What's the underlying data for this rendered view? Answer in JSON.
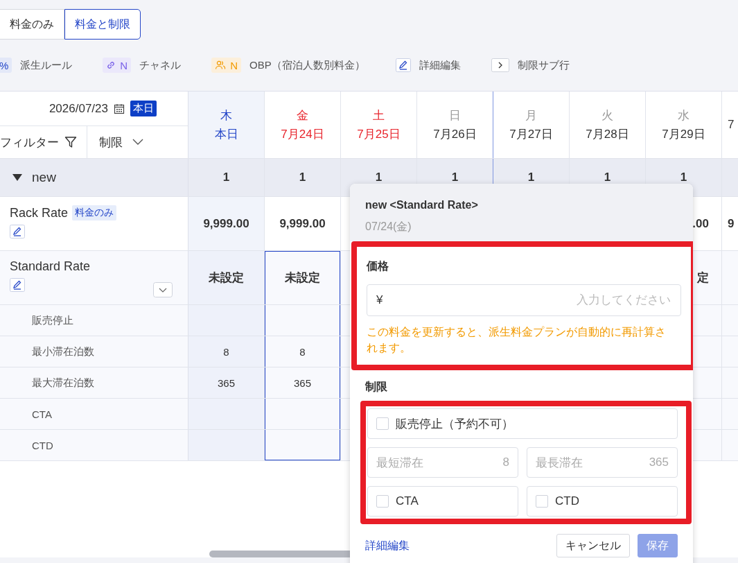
{
  "tabs": [
    {
      "label": "料金のみ",
      "selected": false
    },
    {
      "label": "料金と制限",
      "selected": true
    }
  ],
  "legend": [
    {
      "kind": "percent",
      "badge": "%",
      "label": "派生ルール"
    },
    {
      "kind": "link",
      "badge": "N",
      "label": "チャネル"
    },
    {
      "kind": "people",
      "badge": "N",
      "label": "OBP（宿泊人数別料金）"
    },
    {
      "kind": "edit",
      "label": "詳細編集"
    },
    {
      "kind": "chevron",
      "label": "制限サブ行"
    }
  ],
  "table": {
    "date_picker": {
      "date": "2026/07/23",
      "today_button": "本日"
    },
    "filter": {
      "label": "フィルター"
    },
    "view_select": {
      "value": "制限"
    },
    "columns": [
      {
        "weekday": "木",
        "date": "本日",
        "kind": "today",
        "selected": false
      },
      {
        "weekday": "金",
        "date": "7月24日",
        "kind": "holiday",
        "selected": true
      },
      {
        "weekday": "土",
        "date": "7月25日",
        "kind": "holiday",
        "selected": false
      },
      {
        "weekday": "日",
        "date": "7月26日",
        "kind": "plain",
        "selected": false
      },
      {
        "weekday": "月",
        "date": "7月27日",
        "kind": "plain",
        "selected": false,
        "week_start": true
      },
      {
        "weekday": "火",
        "date": "7月28日",
        "kind": "plain",
        "selected": false
      },
      {
        "weekday": "水",
        "date": "7月29日",
        "kind": "plain",
        "selected": false
      },
      {
        "date": "7",
        "kind": "edge",
        "selected": false
      }
    ],
    "group": {
      "name": "new",
      "expanded": true,
      "counts": [
        "1",
        "1",
        "1",
        "1",
        "1",
        "1",
        "1"
      ]
    },
    "rates": [
      {
        "name": "Rack Rate",
        "tag": "料金のみ",
        "cells": [
          {
            "kind": "value",
            "text": "9,999.00"
          },
          {
            "kind": "value",
            "text": "9,999.00"
          },
          {
            "kind": "empty"
          },
          {
            "kind": "empty"
          },
          {
            "kind": "empty"
          },
          {
            "kind": "empty"
          },
          {
            "kind": "tail",
            "text": ".00"
          },
          {
            "kind": "head",
            "text": "9"
          }
        ]
      },
      {
        "name": "Standard Rate",
        "expanded": true,
        "cells": [
          {
            "kind": "value",
            "text": "未設定"
          },
          {
            "kind": "value",
            "text": "未設定"
          },
          {
            "kind": "empty"
          },
          {
            "kind": "empty"
          },
          {
            "kind": "empty"
          },
          {
            "kind": "empty"
          },
          {
            "kind": "tail",
            "text": "定"
          }
        ],
        "children": [
          {
            "name": "販売停止"
          },
          {
            "name": "最小滞在泊数",
            "values": [
              "8",
              "8"
            ]
          },
          {
            "name": "最大滞在泊数",
            "values": [
              "365",
              "365"
            ]
          },
          {
            "name": "CTA"
          },
          {
            "name": "CTD"
          }
        ]
      }
    ]
  },
  "popup": {
    "title": "new <Standard Rate>",
    "date": "07/24(金)",
    "price": {
      "label": "価格",
      "prefix": "¥",
      "placeholder": "入力してください"
    },
    "warning": "この料金を更新すると、派生料金プランが自動的に再計算されます。",
    "restrictions_label": "制限",
    "stop_sell": {
      "label": "販売停止（予約不可）",
      "checked": false
    },
    "min_stay": {
      "label": "最短滞在",
      "value": "8"
    },
    "max_stay": {
      "label": "最長滞在",
      "value": "365"
    },
    "cta": {
      "label": "CTA",
      "checked": false
    },
    "ctd": {
      "label": "CTD",
      "checked": false
    },
    "link": "詳細編集",
    "cancel": "キャンセル",
    "save": {
      "label": "保存",
      "disabled": true
    }
  }
}
